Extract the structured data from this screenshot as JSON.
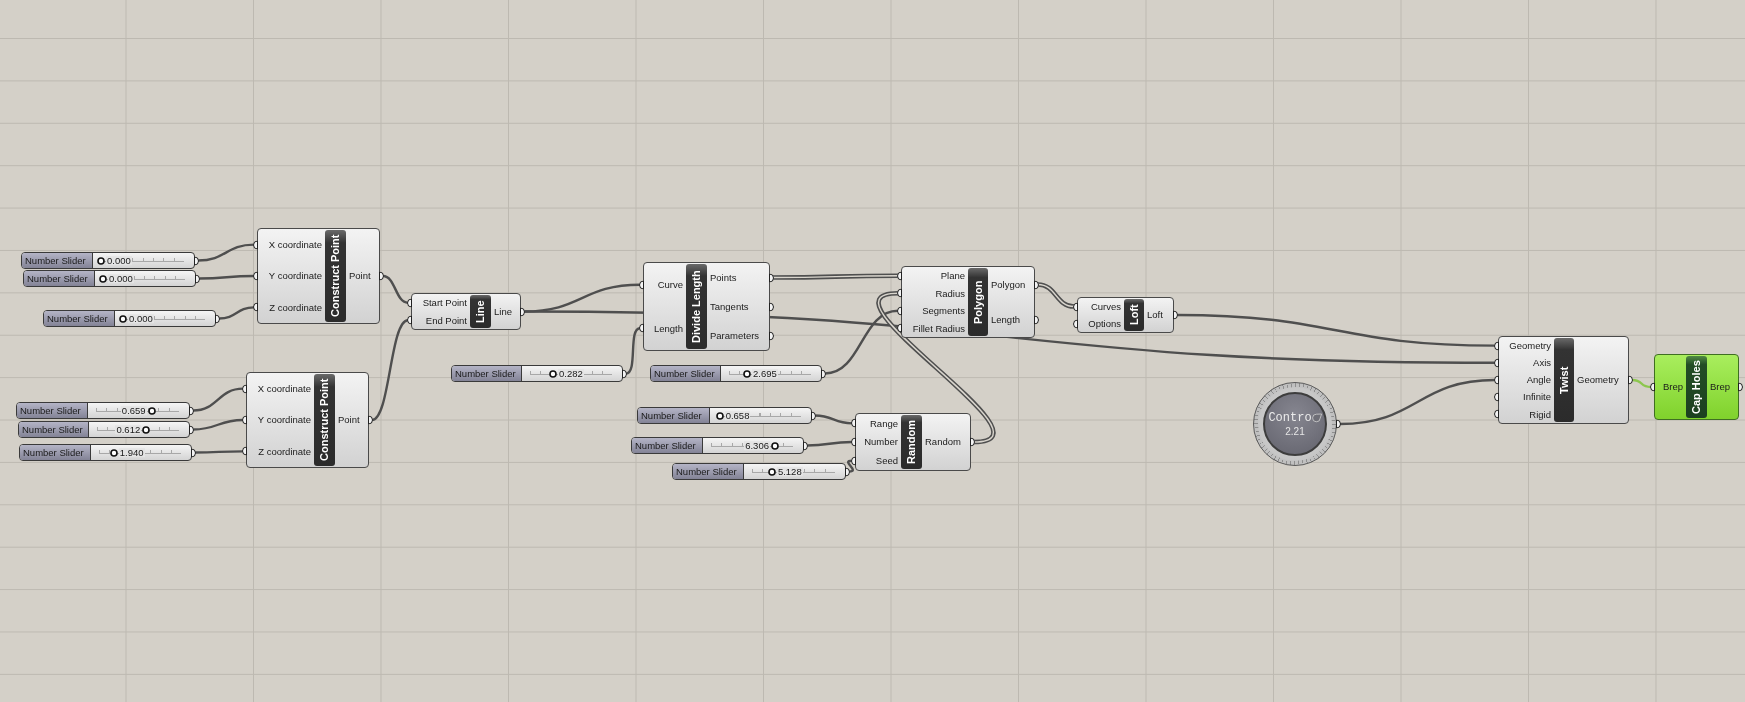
{
  "canvas": {
    "sliders": [
      {
        "label": "Number Slider",
        "value": "0.000",
        "level": 0
      },
      {
        "label": "Number Slider",
        "value": "0.000",
        "level": 0
      },
      {
        "label": "Number Slider",
        "value": "0.000",
        "level": 0
      },
      {
        "label": "Number Slider",
        "value": "0.282",
        "level": 0.28
      },
      {
        "label": "Number Slider",
        "value": "2.695",
        "level": 0.22
      },
      {
        "label": "Number Slider",
        "value": "0.659",
        "level": 0.67
      },
      {
        "label": "Number Slider",
        "value": "0.658",
        "level": 0.02
      },
      {
        "label": "Number Slider",
        "value": "0.612",
        "level": 0.6
      },
      {
        "label": "Number Slider",
        "value": "6.306",
        "level": 0.78
      },
      {
        "label": "Number Slider",
        "value": "1.940",
        "level": 0.18
      },
      {
        "label": "Number Slider",
        "value": "5.128",
        "level": 0.24
      }
    ],
    "components": [
      {
        "title": "Construct Point",
        "selected": false,
        "inputs": [
          "X coordinate",
          "Y coordinate",
          "Z coordinate"
        ],
        "outputs": [
          "Point"
        ]
      },
      {
        "title": "Construct Point",
        "selected": false,
        "inputs": [
          "X coordinate",
          "Y coordinate",
          "Z coordinate"
        ],
        "outputs": [
          "Point"
        ]
      },
      {
        "title": "Line",
        "selected": false,
        "inputs": [
          "Start Point",
          "End Point"
        ],
        "outputs": [
          "Line"
        ]
      },
      {
        "title": "Divide Length",
        "selected": false,
        "inputs": [
          "Curve",
          "Length"
        ],
        "outputs": [
          "Points",
          "Tangents",
          "Parameters"
        ]
      },
      {
        "title": "Random",
        "selected": false,
        "inputs": [
          "Range",
          "Number",
          "Seed"
        ],
        "outputs": [
          "Random"
        ]
      },
      {
        "title": "Polygon",
        "selected": false,
        "inputs": [
          "Plane",
          "Radius",
          "Segments",
          "Fillet Radius"
        ],
        "outputs": [
          "Polygon",
          "Length"
        ]
      },
      {
        "title": "Loft",
        "selected": false,
        "inputs": [
          "Curves",
          "Options"
        ],
        "outputs": [
          "Loft"
        ]
      },
      {
        "title": "Twist",
        "selected": false,
        "inputs": [
          "Geometry",
          "Axis",
          "Angle",
          "Infinite",
          "Rigid"
        ],
        "outputs": [
          "Geometry"
        ]
      },
      {
        "title": "Cap Holes",
        "selected": true,
        "inputs": [
          "Brep"
        ],
        "outputs": [
          "Brep"
        ]
      }
    ],
    "control_knob": {
      "label": "Contro",
      "value": "2.21"
    }
  }
}
